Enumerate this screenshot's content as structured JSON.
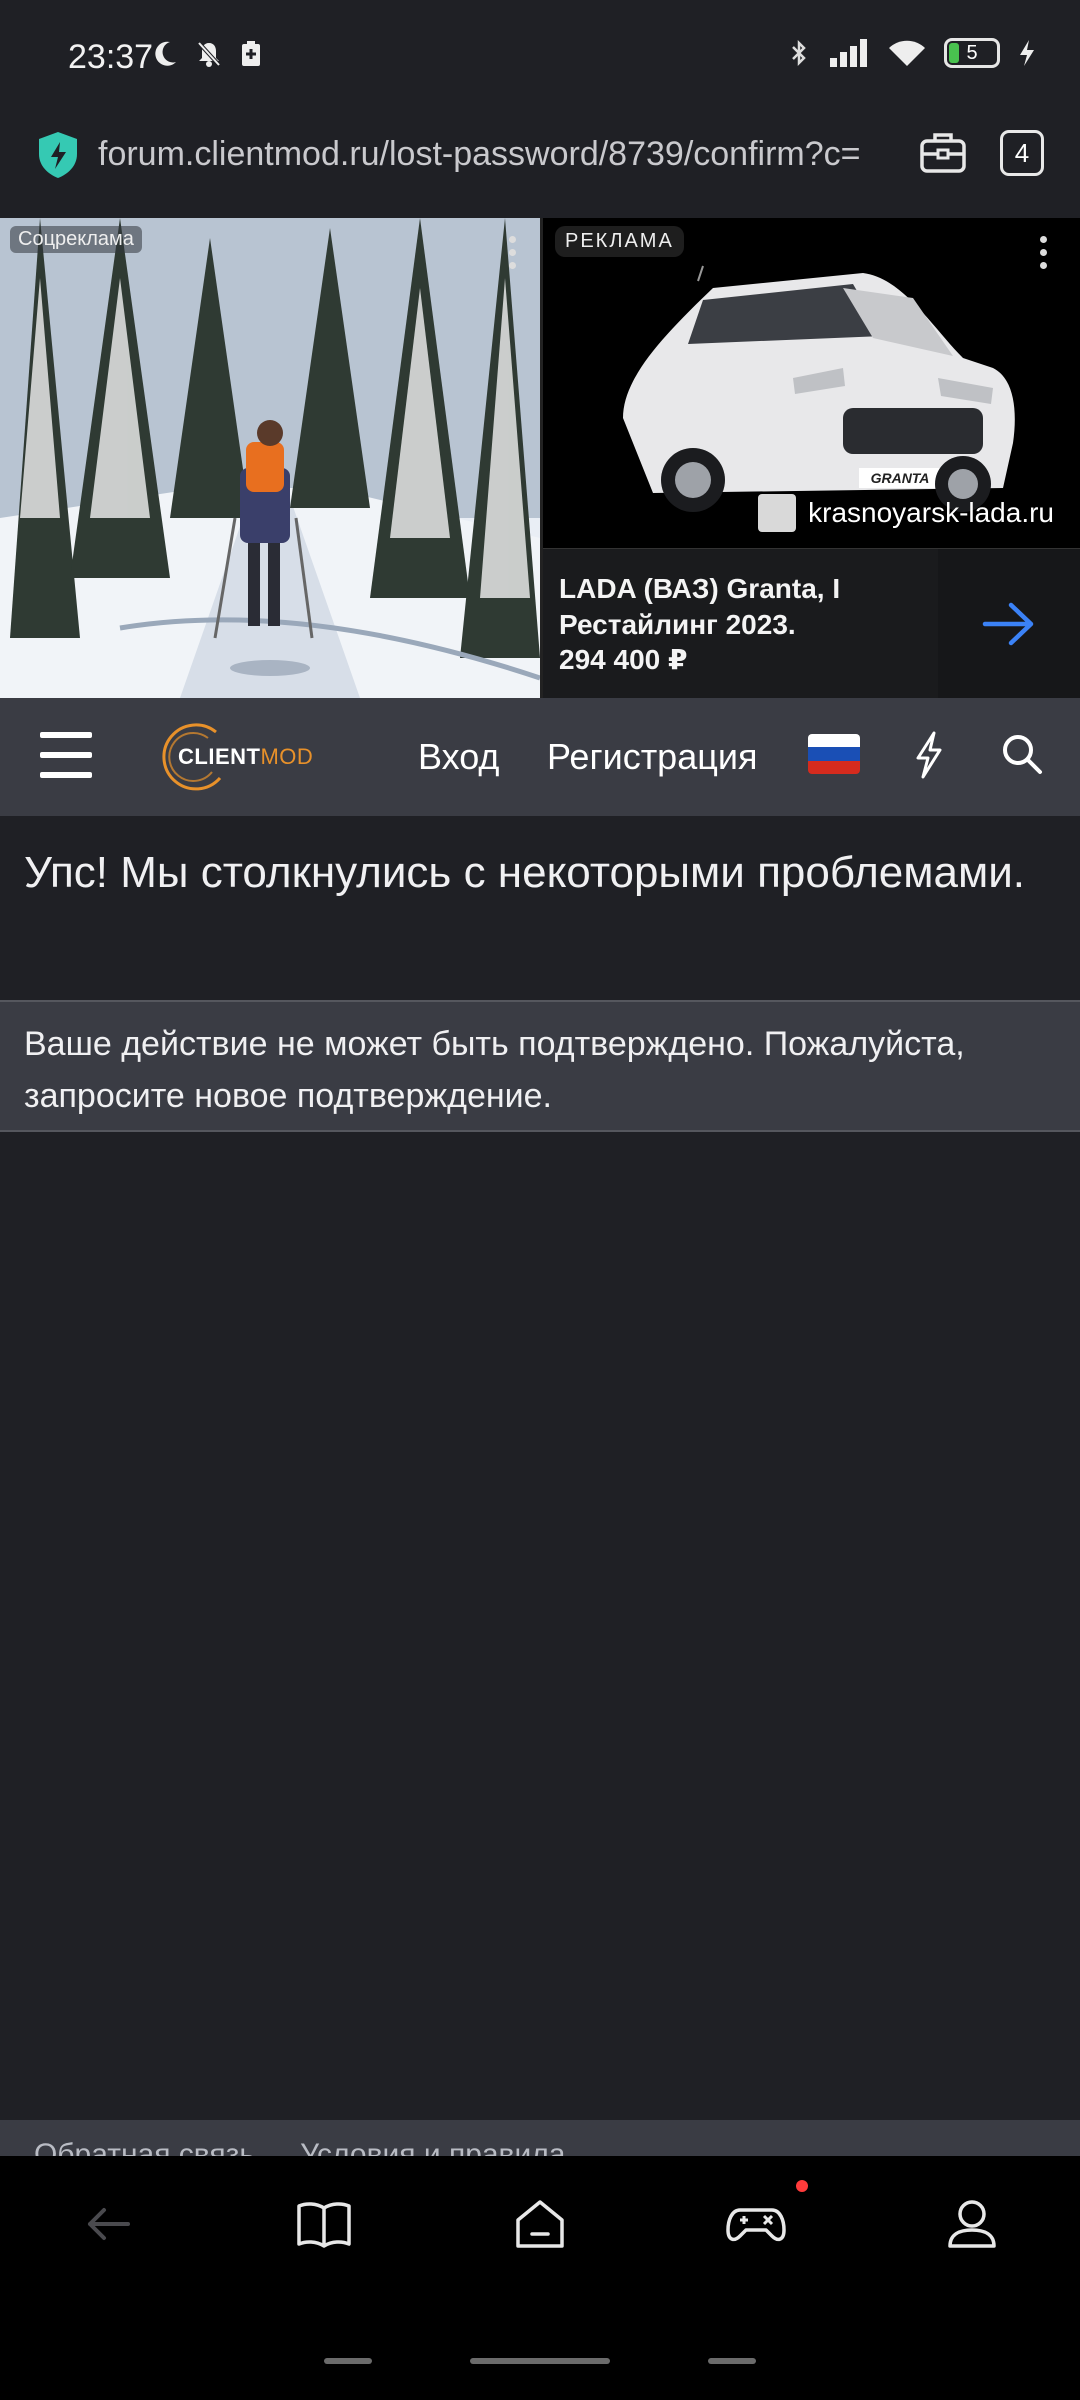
{
  "status_bar": {
    "time": "23:37",
    "battery_level": "5",
    "left_icons": [
      "moon-icon",
      "bell-off-icon",
      "battery-saver-icon"
    ],
    "right_icons": [
      "bluetooth-icon",
      "signal-icon",
      "wifi-icon",
      "battery-icon",
      "charging-icon"
    ]
  },
  "browser": {
    "url": "forum.clientmod.ru/lost-password/8739/confirm?c=",
    "tabs_count": "4"
  },
  "ads": {
    "social_label": "Соцреклама",
    "main_label": "РЕКЛАМА",
    "domain": "krasnoyarsk-lada.ru",
    "title": "LADA (ВАЗ) Granta, I Рестайлинг 2023.",
    "price": "294 400 ₽",
    "car_badge": "GRANTA"
  },
  "header": {
    "logo_main": "CLIENT",
    "logo_accent": "MOD",
    "login_label": "Вход",
    "register_label": "Регистрация",
    "flag_colors": [
      "#ffffff",
      "#1a4fb5",
      "#d52b1e"
    ]
  },
  "content": {
    "error_title": "Упс! Мы столкнулись с некоторыми проблемами.",
    "error_message": "Ваше действие не может быть подтверждено. Пожалуйста, запросите новое подтверждение."
  },
  "footer": {
    "link1": "Обратная связь",
    "link2": "Условия и правила"
  },
  "colors": {
    "background": "#1f2025",
    "panel": "#3a3c44",
    "accent_orange": "#e8912a",
    "arrow_blue": "#3b82f6",
    "shield_teal": "#35c9b3"
  }
}
